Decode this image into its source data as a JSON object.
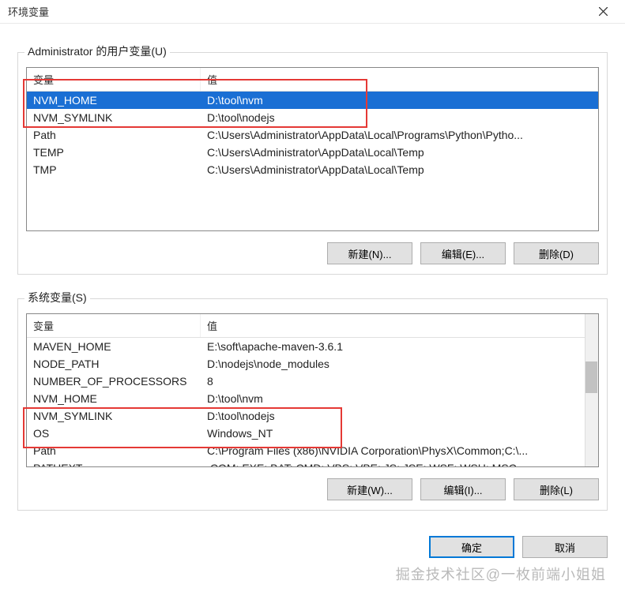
{
  "window": {
    "title": "环境变量"
  },
  "user_vars": {
    "group_label": "Administrator 的用户变量(U)",
    "header_name": "变量",
    "header_value": "值",
    "rows": [
      {
        "name": "NVM_HOME",
        "value": "D:\\tool\\nvm",
        "selected": true
      },
      {
        "name": "NVM_SYMLINK",
        "value": "D:\\tool\\nodejs",
        "selected": false
      },
      {
        "name": "Path",
        "value": "C:\\Users\\Administrator\\AppData\\Local\\Programs\\Python\\Pytho...",
        "selected": false
      },
      {
        "name": "TEMP",
        "value": "C:\\Users\\Administrator\\AppData\\Local\\Temp",
        "selected": false
      },
      {
        "name": "TMP",
        "value": "C:\\Users\\Administrator\\AppData\\Local\\Temp",
        "selected": false
      }
    ],
    "btn_new": "新建(N)...",
    "btn_edit": "编辑(E)...",
    "btn_delete": "删除(D)"
  },
  "sys_vars": {
    "group_label": "系统变量(S)",
    "header_name": "变量",
    "header_value": "值",
    "rows": [
      {
        "name": "MAVEN_HOME",
        "value": "E:\\soft\\apache-maven-3.6.1"
      },
      {
        "name": "NODE_PATH",
        "value": "D:\\nodejs\\node_modules"
      },
      {
        "name": "NUMBER_OF_PROCESSORS",
        "value": "8"
      },
      {
        "name": "NVM_HOME",
        "value": "D:\\tool\\nvm"
      },
      {
        "name": "NVM_SYMLINK",
        "value": "D:\\tool\\nodejs"
      },
      {
        "name": "OS",
        "value": "Windows_NT"
      },
      {
        "name": "Path",
        "value": "C:\\Program Files (x86)\\NVIDIA Corporation\\PhysX\\Common;C:\\..."
      },
      {
        "name": "PATHEXT",
        "value": ".COM;.EXE;.BAT;.CMD;.VBS;.VBE;.JS;.JSE;.WSF;.WSH;.MSC"
      }
    ],
    "btn_new": "新建(W)...",
    "btn_edit": "编辑(I)...",
    "btn_delete": "删除(L)"
  },
  "dialog": {
    "ok": "确定",
    "cancel": "取消"
  },
  "watermark": "掘金技术社区@一枚前端小姐姐"
}
